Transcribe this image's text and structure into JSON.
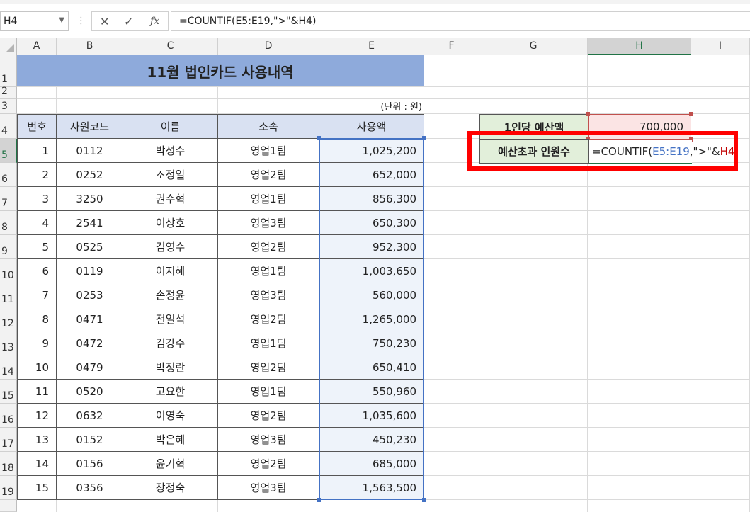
{
  "formula_bar": {
    "name_box": "H4",
    "fx_symbol": "fx",
    "cancel_symbol": "✕",
    "enter_symbol": "✓",
    "formula": "=COUNTIF(E5:E19,\">\"&H4)"
  },
  "columns": [
    "A",
    "B",
    "C",
    "D",
    "E",
    "F",
    "G",
    "H",
    "I"
  ],
  "rows": [
    "1",
    "2",
    "3",
    "4",
    "5",
    "6",
    "7",
    "8",
    "9",
    "10",
    "11",
    "12",
    "13",
    "14",
    "15",
    "16",
    "17",
    "18",
    "19"
  ],
  "sheet": {
    "title": "11월 법인카드 사용내역",
    "unit": "(단위 : 원)",
    "headers": [
      "번호",
      "사원코드",
      "이름",
      "소속",
      "사용액"
    ],
    "records": [
      [
        "1",
        "0112",
        "박성수",
        "영업1팀",
        "1,025,200"
      ],
      [
        "2",
        "0252",
        "조정일",
        "영업2팀",
        "652,000"
      ],
      [
        "3",
        "3250",
        "권수혁",
        "영업1팀",
        "856,300"
      ],
      [
        "4",
        "2541",
        "이상호",
        "영업3팀",
        "650,300"
      ],
      [
        "5",
        "0525",
        "김영수",
        "영업2팀",
        "952,300"
      ],
      [
        "6",
        "0119",
        "이지혜",
        "영업1팀",
        "1,003,650"
      ],
      [
        "7",
        "0253",
        "손정윤",
        "영업3팀",
        "560,000"
      ],
      [
        "8",
        "0471",
        "전일석",
        "영업2팀",
        "1,265,000"
      ],
      [
        "9",
        "0472",
        "김강수",
        "영업1팀",
        "750,230"
      ],
      [
        "10",
        "0479",
        "박정란",
        "영업2팀",
        "650,410"
      ],
      [
        "11",
        "0520",
        "고요한",
        "영업1팀",
        "550,960"
      ],
      [
        "12",
        "0632",
        "이영숙",
        "영업2팀",
        "1,035,600"
      ],
      [
        "13",
        "0152",
        "박은혜",
        "영업3팀",
        "450,230"
      ],
      [
        "14",
        "0156",
        "윤기혁",
        "영업2팀",
        "685,000"
      ],
      [
        "15",
        "0356",
        "장정숙",
        "영업3팀",
        "1,563,500"
      ]
    ],
    "budget_label": "1인당 예산액",
    "budget_value": "700,000",
    "over_label": "예산초과 인원수",
    "over_formula": {
      "prefix": "=COUNTIF(",
      "range": "E5:E19",
      "mid": ",\">\"&",
      "ref": "H4",
      "suffix": ")"
    }
  },
  "colors": {
    "title_fill": "#8eaadb",
    "header_fill": "#d9e1f2",
    "label_fill": "#e2efda",
    "value_fill": "#fbe4e4",
    "highlight_border": "#ff0000",
    "excel_green": "#217346"
  }
}
